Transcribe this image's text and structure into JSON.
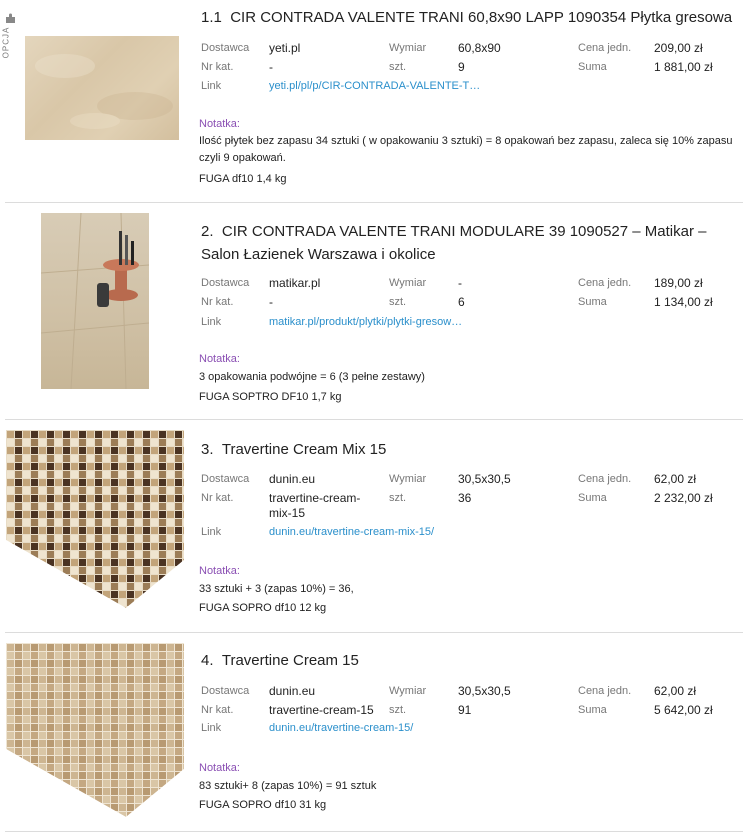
{
  "labels": {
    "supplier": "Dostawca",
    "catalog": "Nr kat.",
    "link": "Link",
    "size": "Wymiar",
    "qty": "szt.",
    "unit_price": "Cena jedn.",
    "sum": "Suma",
    "note": "Notatka:",
    "option_tag": "OPCJA"
  },
  "items": [
    {
      "number": "1.1",
      "title": "CIR CONTRADA VALENTE TRANI 60,8x90 LAPP 1090354 Płytka gresowa",
      "supplier": "yeti.pl",
      "catalog": "-",
      "link": "yeti.pl/pl/p/CIR-CONTRADA-VALENTE-T…",
      "size": "60,8x90",
      "qty": "9",
      "unit_price": "209,00 zł",
      "sum": "1 881,00 zł",
      "note_lines": [
        "Ilość płytek bez zapasu 34 sztuki ( w opakowaniu 3 sztuki) = 8 opakowań bez zapasu, zaleca się 10% zapasu",
        "czyli 9 opakowań.",
        "FUGA df10 1,4 kg"
      ]
    },
    {
      "number": "2.",
      "title": "CIR CONTRADA VALENTE TRANI MODULARE 39 1090527 – Matikar – Salon Łazienek Warszawa i okolice",
      "supplier": "matikar.pl",
      "catalog": "-",
      "link": "matikar.pl/produkt/plytki/plytki-gresow…",
      "size": "-",
      "qty": "6",
      "unit_price": "189,00 zł",
      "sum": "1 134,00 zł",
      "note_lines": [
        "3 opakowania podwójne = 6 (3 pełne zestawy)",
        "FUGA SOPTRO DF10 1,7 kg"
      ]
    },
    {
      "number": "3.",
      "title": "Travertine Cream Mix 15",
      "supplier": "dunin.eu",
      "catalog": "travertine-cream-mix-15",
      "link": "dunin.eu/travertine-cream-mix-15/",
      "size": "30,5x30,5",
      "qty": "36",
      "unit_price": "62,00 zł",
      "sum": "2 232,00 zł",
      "note_lines": [
        "33 sztuki + 3 (zapas 10%) = 36,",
        "FUGA SOPRO df10 12 kg"
      ]
    },
    {
      "number": "4.",
      "title": "Travertine Cream 15",
      "supplier": "dunin.eu",
      "catalog": "travertine-cream-15",
      "link": "dunin.eu/travertine-cream-15/",
      "size": "30,5x30,5",
      "qty": "91",
      "unit_price": "62,00 zł",
      "sum": "5 642,00 zł",
      "note_lines": [
        "83 sztuki+ 8 (zapas 10%) = 91 sztuk",
        "FUGA SOPRO df10 31 kg"
      ]
    }
  ]
}
